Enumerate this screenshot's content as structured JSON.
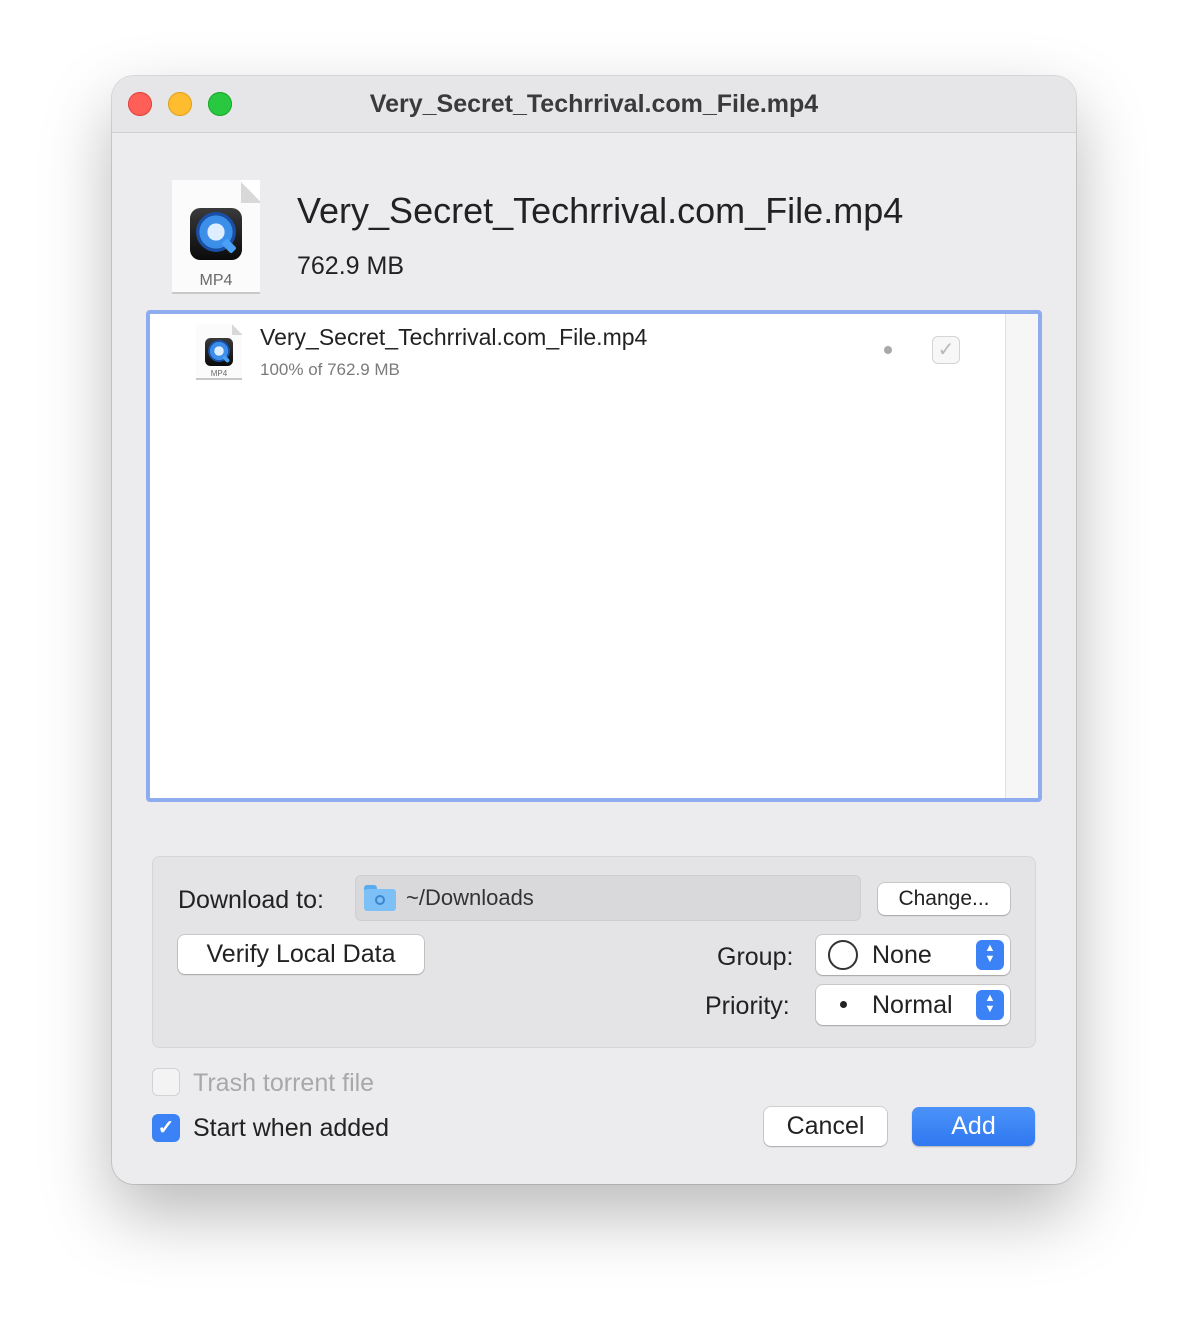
{
  "window": {
    "title": "Very_Secret_Techrrival.com_File.mp4"
  },
  "header": {
    "file_name": "Very_Secret_Techrrival.com_File.mp4",
    "file_size": "762.9 MB",
    "icon_ext": "MP4",
    "icon": "quicktime-mp4-file-icon"
  },
  "file_list": {
    "items": [
      {
        "name": "Very_Secret_Techrrival.com_File.mp4",
        "progress": "100% of 762.9 MB",
        "icon_ext": "MP4",
        "checked": true
      }
    ]
  },
  "options": {
    "download_label": "Download to:",
    "download_path": "~/Downloads",
    "change_button": "Change...",
    "verify_button": "Verify Local Data",
    "group_label": "Group:",
    "group_value": "None",
    "priority_label": "Priority:",
    "priority_value": "Normal"
  },
  "footer": {
    "trash_label": "Trash torrent file",
    "trash_checked": false,
    "start_label": "Start when added",
    "start_checked": true,
    "cancel_button": "Cancel",
    "add_button": "Add"
  },
  "colors": {
    "accent": "#3b82f6",
    "close": "#ff5f57",
    "minimize": "#febc2e",
    "maximize": "#28c840",
    "focus_ring": "#8fadee"
  }
}
